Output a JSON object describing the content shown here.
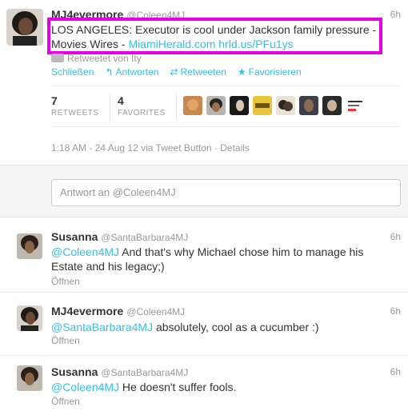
{
  "main_tweet": {
    "fullname": "MJ4evermore",
    "username": "@Coleen4MJ",
    "time": "6h",
    "text_prefix": "LOS ANGELES: Executor is cool under Jackson family pressure - Movies Wires - ",
    "link1": "MiamiHerald.com",
    "link2": "hrld.us/PFu1ys",
    "retweeted_by": "Retweetet von Ity",
    "actions": {
      "close": "Schließen",
      "reply": "Antworten",
      "retweet": "Retweeten",
      "favorite": "Favorisieren"
    },
    "stats": {
      "retweets_value": "7",
      "retweets_label": "RETWEETS",
      "favorites_value": "4",
      "favorites_label": "FAVORITES"
    },
    "meta": "1:18 AM - 24 Aug 12 via Tweet Button · Details"
  },
  "reply_box": {
    "placeholder": "Antwort an @Coleen4MJ"
  },
  "replies": [
    {
      "fullname": "Susanna",
      "username": "@SantaBarbara4MJ",
      "time": "6h",
      "mention": "@Coleen4MJ",
      "text": " And that's why Michael chose him to manage his Estate and his legacy;)",
      "open": "Öffnen"
    },
    {
      "fullname": "MJ4evermore",
      "username": "@Coleen4MJ",
      "time": "6h",
      "mention": "@SantaBarbara4MJ",
      "text": " absolutely, cool as a cucumber :)",
      "open": "Öffnen"
    },
    {
      "fullname": "Susanna",
      "username": "@SantaBarbara4MJ",
      "time": "6h",
      "mention": "@Coleen4MJ",
      "text": " He doesn't suffer fools.",
      "open": "Öffnen"
    }
  ],
  "colors": {
    "link": "#2fc2ef",
    "highlight": "#e600e6"
  }
}
